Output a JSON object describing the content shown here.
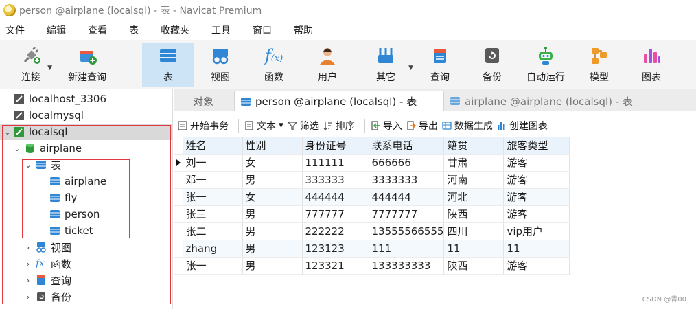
{
  "window": {
    "title": "person @airplane (localsql) - 表 - Navicat Premium"
  },
  "menu": [
    "文件",
    "编辑",
    "查看",
    "表",
    "收藏夹",
    "工具",
    "窗口",
    "帮助"
  ],
  "toolbar": {
    "connect": "连接",
    "new_query": "新建查询",
    "table": "表",
    "view": "视图",
    "function": "函数",
    "user": "用户",
    "other": "其它",
    "query": "查询",
    "backup": "备份",
    "automation": "自动运行",
    "model": "模型",
    "chart": "图表"
  },
  "sidebar": {
    "connections": [
      "localhost_3306",
      "localmysql",
      "localsql"
    ],
    "database": "airplane",
    "tables_node": "表",
    "tables": [
      "airplane",
      "fly",
      "person",
      "ticket"
    ],
    "views_node": "视图",
    "functions_node": "函数",
    "queries_node": "查询",
    "backups_node": "备份"
  },
  "tabs": {
    "objects": "对象",
    "active": "person @airplane (localsql) - 表",
    "inactive": "airplane @airplane (localsql) - 表"
  },
  "subtoolbar": {
    "begin_transaction": "开始事务",
    "text": "文本",
    "filter": "筛选",
    "sort": "排序",
    "import": "导入",
    "export": "导出",
    "generate_data": "数据生成",
    "create_chart": "创建图表"
  },
  "grid": {
    "columns": [
      "姓名",
      "性别",
      "身份证号",
      "联系电话",
      "籍贯",
      "旅客类型"
    ],
    "rows": [
      [
        "刘一",
        "女",
        "111111",
        "666666",
        "甘肃",
        "游客"
      ],
      [
        "邓一",
        "男",
        "333333",
        "3333333",
        "河南",
        "游客"
      ],
      [
        "张一",
        "女",
        "444444",
        "444444",
        "河北",
        "游客"
      ],
      [
        "张三",
        "男",
        "777777",
        "7777777",
        "陕西",
        "游客"
      ],
      [
        "张二",
        "男",
        "222222",
        "13555566555",
        "四川",
        "vip用户"
      ],
      [
        "zhang",
        "男",
        "123123",
        "111",
        "11",
        "11"
      ],
      [
        "张一",
        "男",
        "123321",
        "133333333",
        "陕西",
        "游客"
      ]
    ]
  },
  "watermark": "CSDN @青00",
  "colors": {
    "accent": "#cde4f7",
    "highlight_box": "#e0383e",
    "header_bg": "#eaf3fb"
  }
}
